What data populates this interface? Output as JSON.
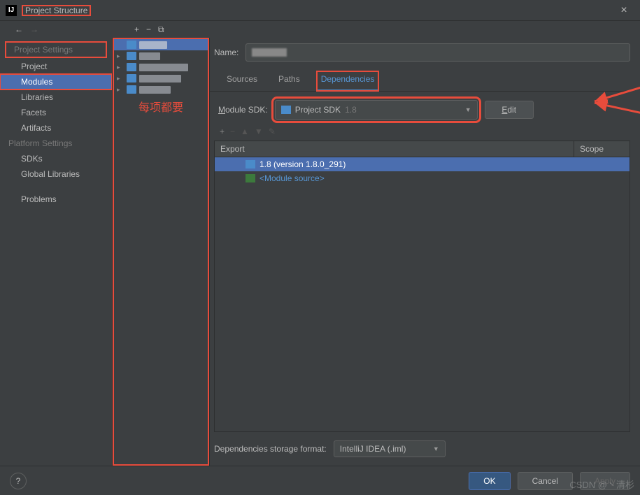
{
  "window": {
    "title": "Project Structure"
  },
  "sidebar": {
    "sections": {
      "project_settings": "Project Settings",
      "platform_settings": "Platform Settings"
    },
    "items": {
      "project": "Project",
      "modules": "Modules",
      "libraries": "Libraries",
      "facets": "Facets",
      "artifacts": "Artifacts",
      "sdks": "SDKs",
      "global_libraries": "Global Libraries",
      "problems": "Problems"
    }
  },
  "annotation": "每项都要",
  "detail": {
    "name_label": "Name:",
    "tabs": {
      "sources": "Sources",
      "paths": "Paths",
      "dependencies": "Dependencies"
    },
    "sdk_label": "Module SDK:",
    "sdk_value": "Project SDK",
    "sdk_version": "1.8",
    "edit_label": "Edit",
    "dep_header": {
      "export": "Export",
      "scope": "Scope"
    },
    "deps": {
      "jdk": "1.8 (version 1.8.0_291)",
      "module_source": "<Module source>"
    },
    "format_label": "Dependencies storage format:",
    "format_value": "IntelliJ IDEA (.iml)"
  },
  "buttons": {
    "ok": "OK",
    "cancel": "Cancel",
    "apply": "Apply"
  },
  "watermark": "CSDN @丶清杉"
}
